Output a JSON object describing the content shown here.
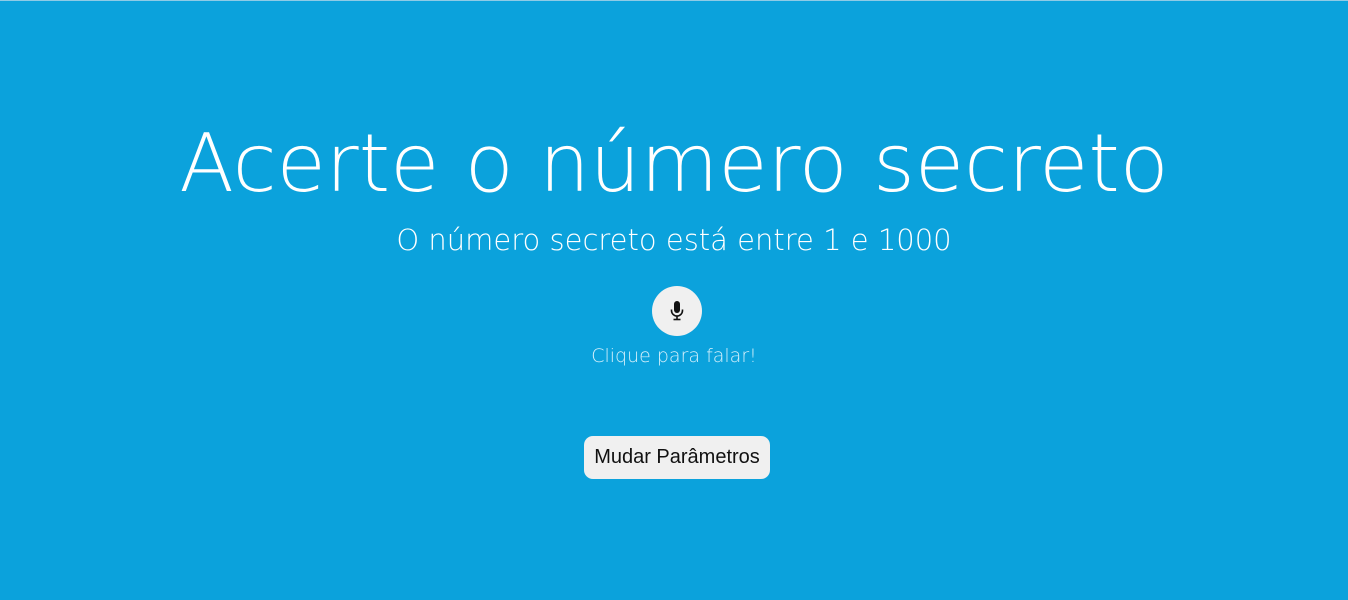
{
  "header": {
    "title": "Acerte o número secreto",
    "subtitle": "O número secreto está entre 1 e 1000"
  },
  "voice": {
    "icon": "microphone-icon",
    "hint": "Clique para falar!"
  },
  "actions": {
    "change_params_label": "Mudar Parâmetros"
  },
  "colors": {
    "background": "#0ba2dc",
    "text": "#ffffff",
    "button_bg": "#f0f0f0",
    "button_text": "#111111"
  }
}
